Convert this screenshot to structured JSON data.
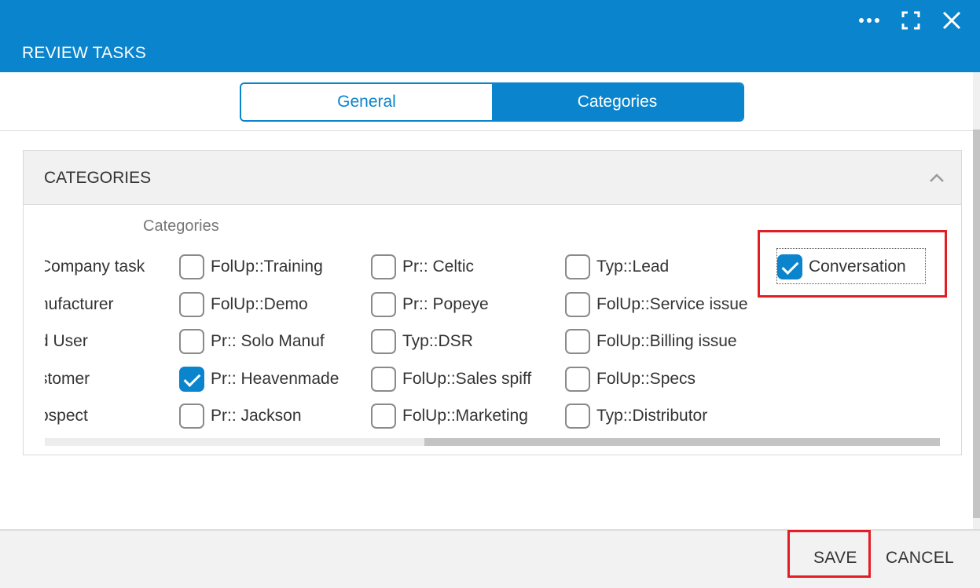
{
  "header": {
    "title": "REVIEW TASKS",
    "color": "#0a84cc",
    "more_icon": "more-horizontal-icon",
    "expand_icon": "expand-icon",
    "close_icon": "close-icon"
  },
  "tabs": [
    {
      "label": "General",
      "active": false
    },
    {
      "label": "Categories",
      "active": true
    }
  ],
  "panel": {
    "title": "CATEGORIES",
    "collapse_icon": "chevron-up-icon",
    "field_label": "Categories"
  },
  "categories": {
    "rows": [
      {
        "first": "Company task",
        "items": [
          {
            "label": "FolUp::Training",
            "checked": false
          },
          {
            "label": "Pr:: Celtic",
            "checked": false
          },
          {
            "label": "Typ::Lead",
            "checked": false
          },
          {
            "label": "Conversation",
            "checked": true
          }
        ]
      },
      {
        "first": "nufacturer",
        "items": [
          {
            "label": "FolUp::Demo",
            "checked": false
          },
          {
            "label": "Pr:: Popeye",
            "checked": false
          },
          {
            "label": "FolUp::Service issue",
            "checked": false
          }
        ]
      },
      {
        "first": "d User",
        "items": [
          {
            "label": "Pr:: Solo Manuf",
            "checked": false
          },
          {
            "label": "Typ::DSR",
            "checked": false
          },
          {
            "label": "FolUp::Billing issue",
            "checked": false
          }
        ]
      },
      {
        "first": "stomer",
        "items": [
          {
            "label": "Pr:: Heavenmade",
            "checked": true
          },
          {
            "label": "FolUp::Sales spiff",
            "checked": false
          },
          {
            "label": "FolUp::Specs",
            "checked": false
          }
        ]
      },
      {
        "first": "ospect",
        "items": [
          {
            "label": "Pr:: Jackson",
            "checked": false
          },
          {
            "label": "FolUp::Marketing",
            "checked": false
          },
          {
            "label": "Typ::Distributor",
            "checked": false
          }
        ]
      }
    ]
  },
  "footer": {
    "save_label": "SAVE",
    "cancel_label": "CANCEL"
  },
  "highlight_color": "#e21d25"
}
